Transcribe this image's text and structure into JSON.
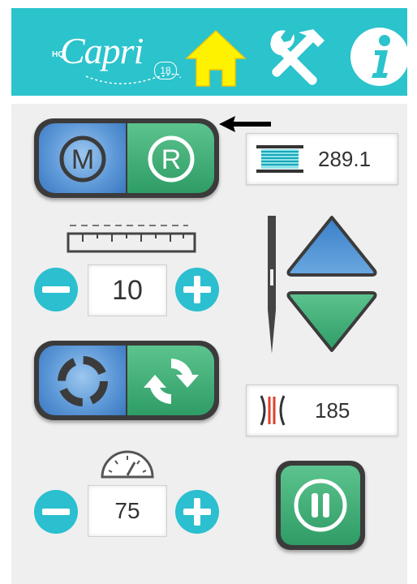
{
  "header": {
    "logo": {
      "prefix": "HQ",
      "name": "Capri",
      "model": "18"
    },
    "nav": {
      "home": "home-icon",
      "tools": "tools-icon",
      "info": "info-icon"
    }
  },
  "mode_toggle": {
    "manual_label": "M",
    "regulated_label": "R",
    "selected": "R"
  },
  "bobbin_counter": {
    "value": "289.1"
  },
  "stitch_length": {
    "value": "10"
  },
  "stitch_counter": {
    "value": "185"
  },
  "cycle_toggle": {
    "left_icon": "dashed-circle-icon",
    "right_icon": "refresh-icon"
  },
  "speed": {
    "value": "75"
  },
  "colors": {
    "header": "#2bc3cc",
    "blue": "#4a8ad0",
    "green": "#3aa873",
    "yellow": "#fff200",
    "teal_button": "#2bbfd0"
  }
}
